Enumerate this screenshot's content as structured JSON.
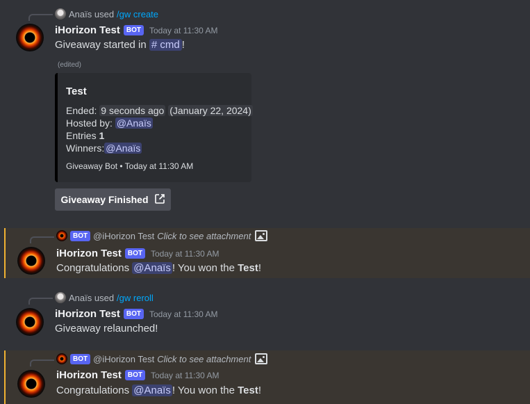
{
  "messages": {
    "m1": {
      "reply_user": "Anaïs used",
      "reply_command": "/gw create",
      "username": "iHorizon Test",
      "bot_tag": "BOT",
      "timestamp": "Today at 11:30 AM",
      "content_prefix": "Giveaway started in",
      "channel": "# cmd",
      "content_suffix": "!",
      "edited": "(edited)",
      "embed": {
        "title": "Test",
        "ended_label": "Ended:",
        "ended_relative": "9 seconds ago",
        "ended_date": "(January 22, 2024)",
        "hosted_label": "Hosted by:",
        "host": "@Anaïs",
        "entries_label": "Entries",
        "entries_value": "1",
        "winners_label": "Winners:",
        "winner": "@Anaïs",
        "footer": "Giveaway Bot • Today at 11:30 AM",
        "color": "#000000"
      },
      "button_label": "Giveaway Finished"
    },
    "m2": {
      "reply_bot_tag": "BOT",
      "reply_user": "@iHorizon Test",
      "reply_text": "Click to see attachment",
      "username": "iHorizon Test",
      "bot_tag": "BOT",
      "timestamp": "Today at 11:30 AM",
      "content_prefix": "Congratulations",
      "mention": "@Anaïs",
      "content_mid": "! You won the",
      "prize": "Test",
      "content_suffix": "!"
    },
    "m3": {
      "reply_user": "Anaïs used",
      "reply_command": "/gw reroll",
      "username": "iHorizon Test",
      "bot_tag": "BOT",
      "timestamp": "Today at 11:30 AM",
      "content": "Giveaway relaunched!"
    },
    "m4": {
      "reply_bot_tag": "BOT",
      "reply_user": "@iHorizon Test",
      "reply_text": "Click to see attachment",
      "username": "iHorizon Test",
      "bot_tag": "BOT",
      "timestamp": "Today at 11:30 AM",
      "content_prefix": "Congratulations",
      "mention": "@Anaïs",
      "content_mid": "! You won the",
      "prize": "Test",
      "content_suffix": "!"
    }
  },
  "colors": {
    "background": "#313338",
    "mention_bg": "#3a3631",
    "mention_bar": "#f0b232",
    "link": "#00a8fc",
    "bot_tag": "#5865f2"
  }
}
